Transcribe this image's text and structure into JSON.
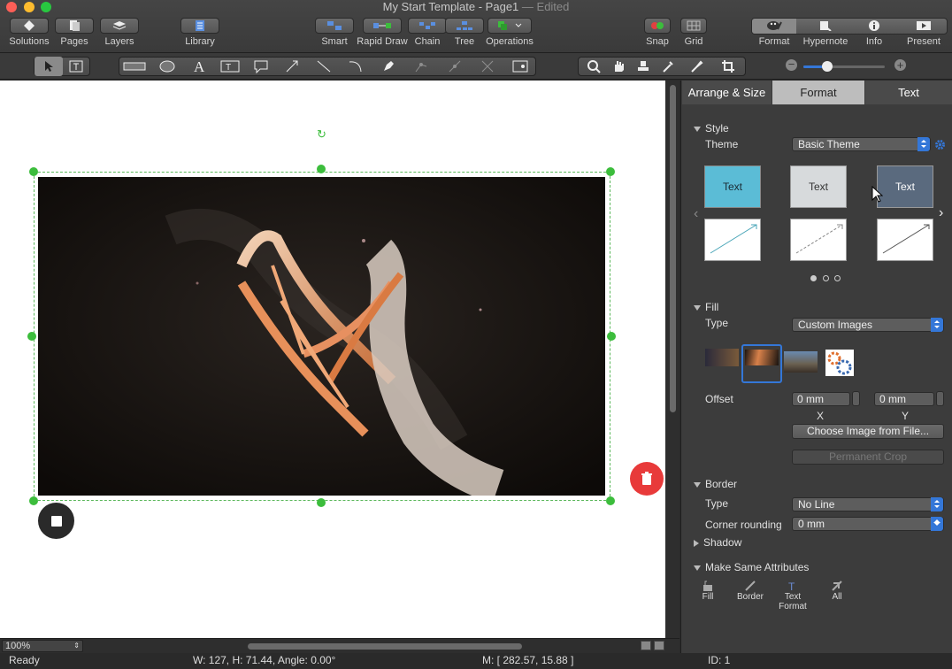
{
  "window": {
    "title": "My Start Template - Page1",
    "edited": "— Edited"
  },
  "toolbar": {
    "left": [
      {
        "label": "Solutions",
        "icon": "solutions-icon"
      },
      {
        "label": "Pages",
        "icon": "pages-icon"
      },
      {
        "label": "Layers",
        "icon": "layers-icon"
      }
    ],
    "library": "Library",
    "center": [
      {
        "label": "Smart"
      },
      {
        "label": "Rapid Draw"
      },
      {
        "label": "Chain"
      },
      {
        "label": "Tree"
      },
      {
        "label": "Operations"
      }
    ],
    "right": [
      {
        "label": "Snap"
      },
      {
        "label": "Grid"
      }
    ],
    "panels": [
      {
        "label": "Format"
      },
      {
        "label": "Hypernote"
      },
      {
        "label": "Info"
      },
      {
        "label": "Present"
      }
    ]
  },
  "panel": {
    "tabs": [
      "Arrange & Size",
      "Format",
      "Text"
    ],
    "style": {
      "header": "Style",
      "theme_label": "Theme",
      "theme_value": "Basic Theme",
      "swatches": [
        "Text",
        "Text",
        "Text"
      ]
    },
    "fill": {
      "header": "Fill",
      "type_label": "Type",
      "type_value": "Custom Images",
      "offset_label": "Offset",
      "offset_x": "0 mm",
      "offset_y": "0 mm",
      "x_label": "X",
      "y_label": "Y",
      "choose_btn": "Choose Image from File...",
      "crop_btn": "Permanent Crop"
    },
    "border": {
      "header": "Border",
      "type_label": "Type",
      "type_value": "No Line",
      "corner_label": "Corner rounding",
      "corner_value": "0 mm"
    },
    "shadow": {
      "header": "Shadow"
    },
    "same": {
      "header": "Make Same Attributes",
      "items": [
        "Fill",
        "Border",
        "Text\nFormat",
        "All"
      ]
    }
  },
  "zoom": "100%",
  "status": {
    "ready": "Ready",
    "dims": "W: 127,  H: 71.44,  Angle: 0.00°",
    "mouse": "M: [ 282.57, 15.88 ]",
    "id": "ID: 1"
  },
  "colors": {
    "accent": "#3477d8",
    "handle": "#3cbd3c",
    "delete": "#e83a3a"
  }
}
